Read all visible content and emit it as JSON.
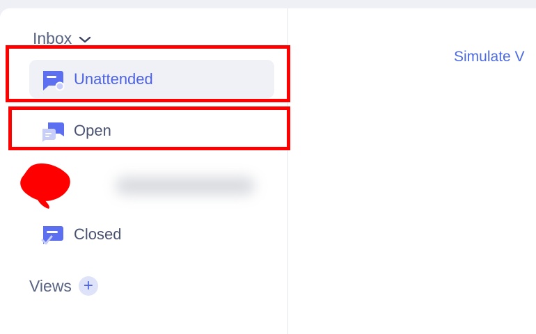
{
  "sidebar": {
    "inbox_label": "Inbox",
    "items": [
      {
        "label": "Unattended",
        "icon": "unattended-chat-icon",
        "active": true
      },
      {
        "label": "Open",
        "icon": "open-chat-icon",
        "active": false
      },
      {
        "label": "",
        "icon": "redacted",
        "active": false
      },
      {
        "label": "Closed",
        "icon": "closed-chat-icon",
        "active": false
      }
    ],
    "views_label": "Views"
  },
  "main": {
    "simulate_link": "Simulate V"
  },
  "colors": {
    "accent": "#4d63e0",
    "highlight": "#ff0000"
  }
}
